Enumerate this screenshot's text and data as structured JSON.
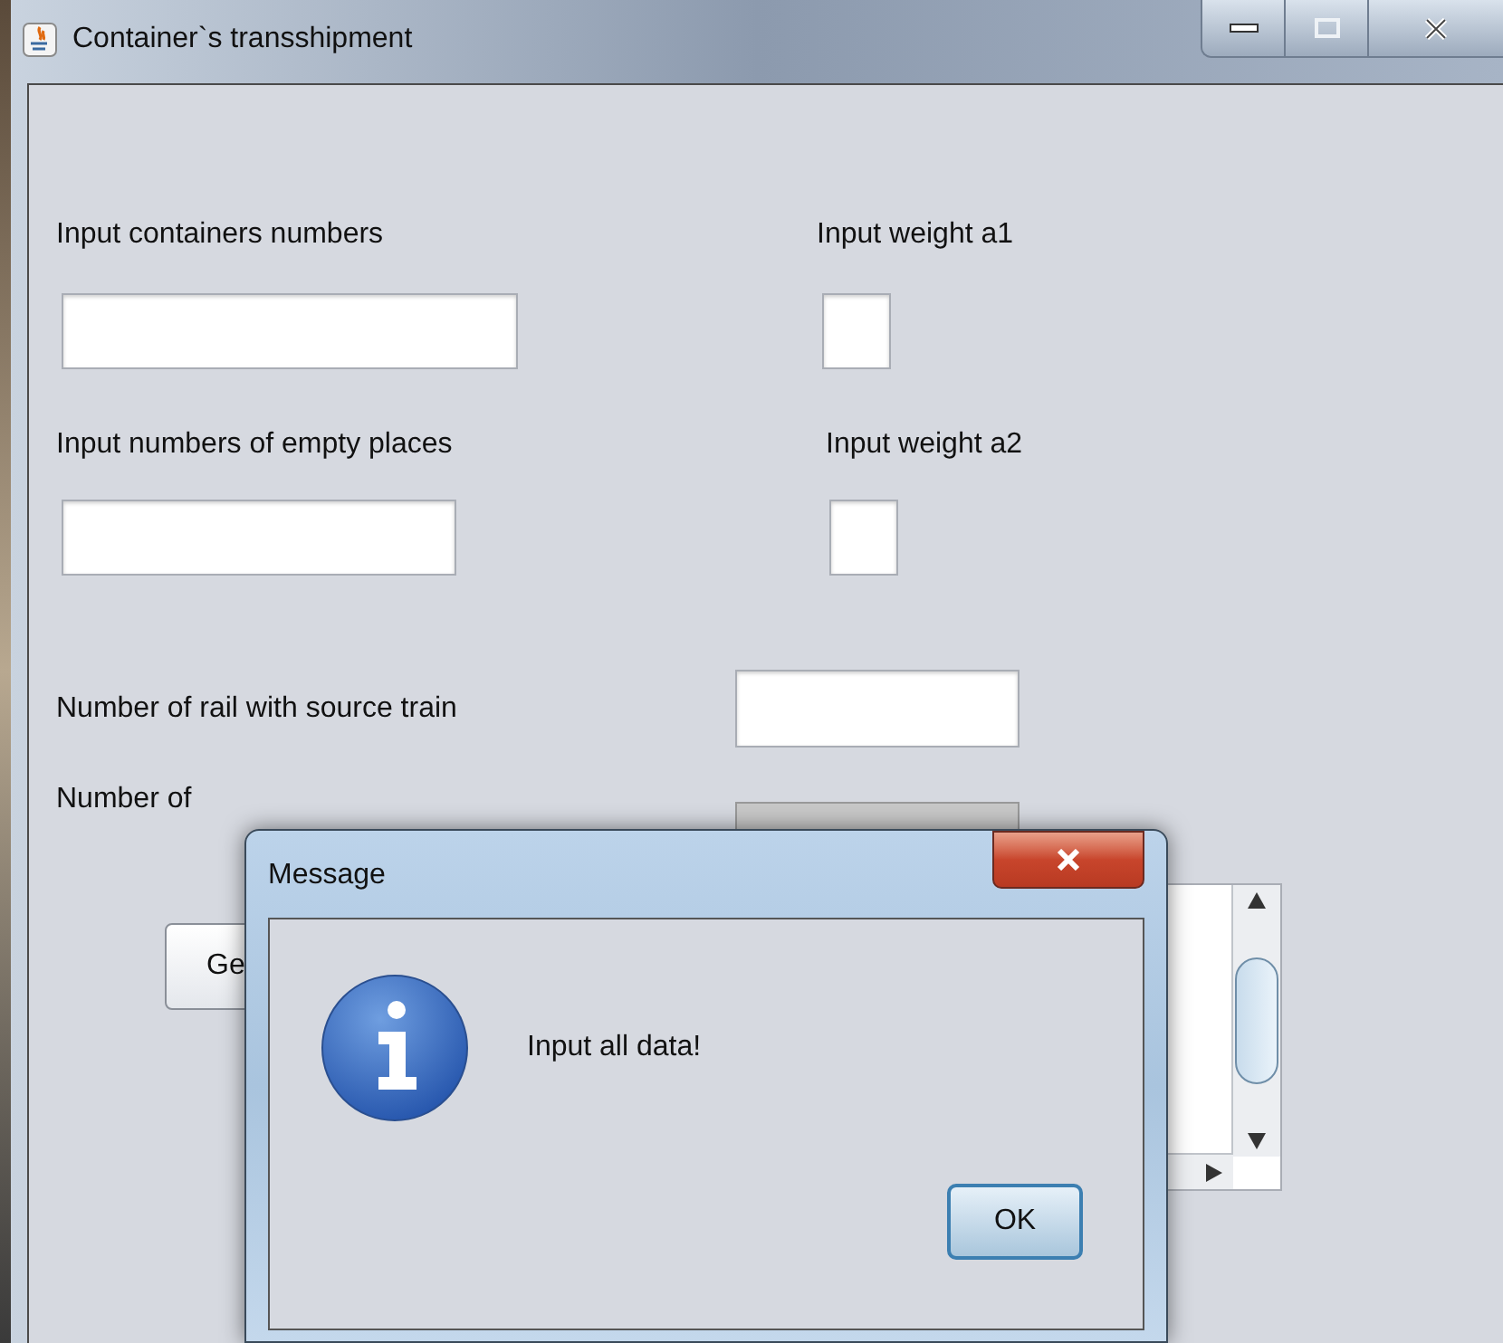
{
  "window": {
    "title": "Container`s transshipment"
  },
  "form": {
    "containers_label": "Input containers numbers",
    "weight_a1_label": "Input weight a1",
    "empty_places_label": "Input numbers of empty places",
    "weight_a2_label": "Input weight a2",
    "source_rail_label": "Number of rail with source train",
    "target_rail_label": "Number of",
    "generate_button": "Ge"
  },
  "dialog": {
    "title": "Message",
    "message": "Input all data!",
    "ok_button": "OK"
  }
}
